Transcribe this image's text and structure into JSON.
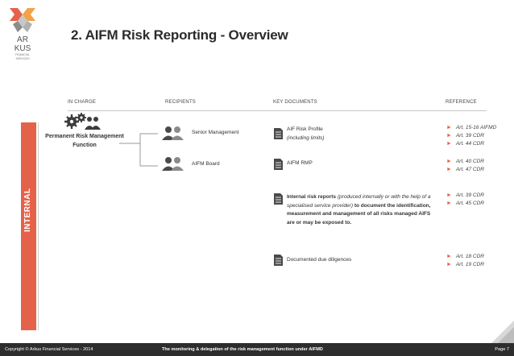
{
  "slide": {
    "title": "2. AIFM Risk Reporting - Overview",
    "logo_text": [
      "AR",
      "KUS",
      "FINANCIAL",
      "SERVICES"
    ]
  },
  "columns": {
    "in_charge": "IN CHARGE",
    "recipients": "RECIPIENTS",
    "key_documents": "KEY DOCUMENTS",
    "reference": "REFERENCE"
  },
  "section": {
    "label": "INTERNAL"
  },
  "in_charge": {
    "label": "Permanent Risk Management Function"
  },
  "recipients": [
    {
      "label": "Senior Management"
    },
    {
      "label": "AIFM Board"
    }
  ],
  "documents": [
    {
      "title": "AIF Risk Profile",
      "subtitle": "(including limits)",
      "references": [
        "Art. 15-16 AIFMD",
        "Art. 39 CDR",
        "Art. 44 CDR"
      ]
    },
    {
      "title": "AIFM RMP",
      "references": [
        "Art. 40 CDR",
        "Art. 47 CDR"
      ]
    },
    {
      "title": "Internal risk reports",
      "paren": "(produced internally or with the help of a specialised service provider)",
      "purpose": "to document the identification, measurement and management of all risks managed AIFS are or may be exposed to.",
      "references": [
        "Art. 39 CDR",
        "Art. 45 CDR"
      ]
    },
    {
      "title": "Documented due diligences",
      "references": [
        "Art. 18 CDR",
        "Art. 19 CDR"
      ]
    }
  ],
  "footer": {
    "copyright": "Copyright © Arkus Financial Services - 2014",
    "subject": "The monitoring & delegation of the risk management function under AIFMD",
    "page": "Page 7"
  },
  "colors": {
    "accent": "#e5624a",
    "footer_bg": "#2d2d2d",
    "title": "#2b2b2b"
  }
}
